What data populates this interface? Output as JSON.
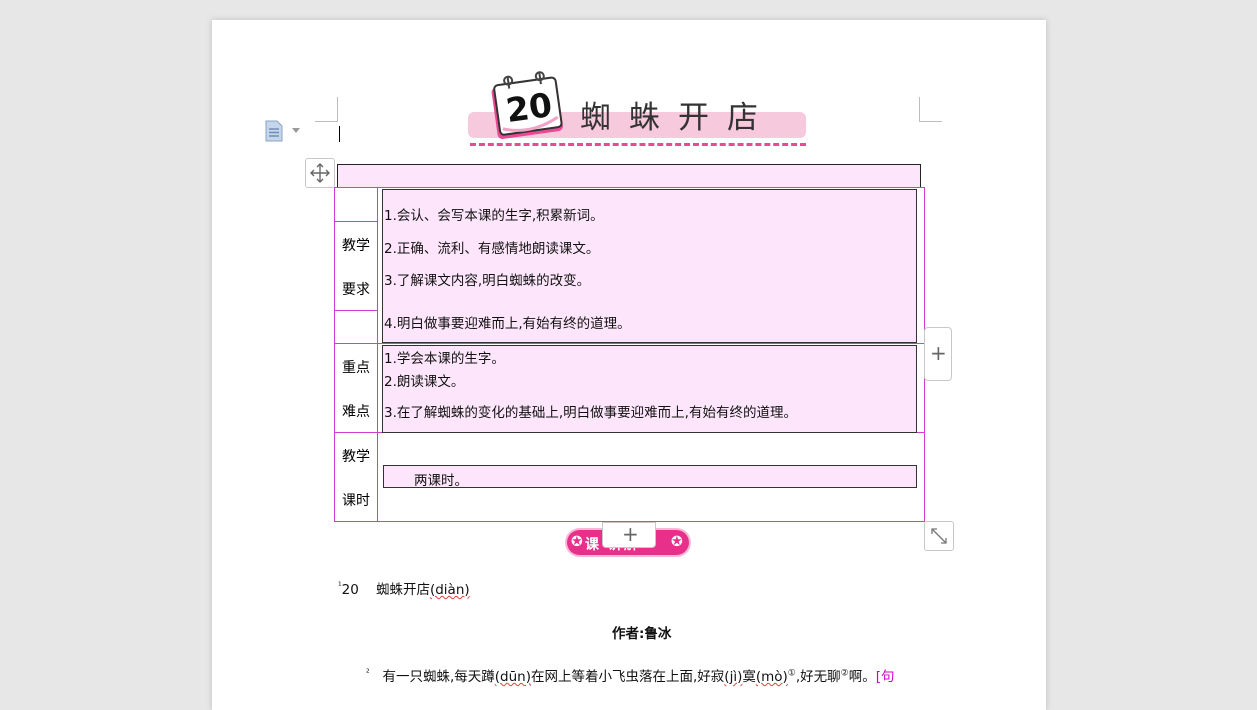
{
  "header": {
    "lesson_number": "20",
    "lesson_title": "蜘蛛开店"
  },
  "table": {
    "rows": [
      {
        "label_lines": [
          "教学",
          "要求"
        ],
        "items": [
          "1.会认、会写本课的生字,积累新词。",
          "2.正确、流利、有感情地朗读课文。",
          "3.了解课文内容,明白蜘蛛的改变。",
          "4.明白做事要迎难而上,有始有终的道理。"
        ]
      },
      {
        "label_lines": [
          "重点",
          "难点"
        ],
        "items": [
          "1.学会本课的生字。",
          "2.朗读课文。",
          "3.在了解蜘蛛的变化的基础上,明白做事要迎难而上,有始有终的道理。"
        ]
      },
      {
        "label_lines": [
          "教学",
          "课时"
        ],
        "items": [
          "两课时。"
        ]
      }
    ],
    "add_row_symbol": "+",
    "add_col_symbol": "+"
  },
  "badge": {
    "text": "课 讲解",
    "star_glyph": "✪"
  },
  "body": {
    "heading_marker": "¹",
    "heading_number": "20",
    "heading_title": "蜘蛛开店",
    "heading_pinyin": "(diàn)",
    "author": "作者:鲁冰",
    "p1_marker": "²",
    "p1_part1": "有一只蜘蛛,每天蹲",
    "p1_pinyin1": "(dūn)",
    "p1_part2": "在网上等着小飞虫落在上面,好寂",
    "p1_pinyin2": "(jì)",
    "p1_part3": "寞",
    "p1_pinyin3": "(mò)",
    "p1_note1": "①",
    "p1_part4": ",好无聊",
    "p1_note2": "②",
    "p1_part5": "啊。",
    "p1_tag": "[句"
  },
  "colors": {
    "accent": "#e8308a",
    "table_border": "#d23cd2",
    "cell_fill": "#fde6fb"
  },
  "icons": [
    "document-icon",
    "move-icon",
    "plus-icon",
    "resize-icon",
    "calendar-icon",
    "star-icon"
  ]
}
